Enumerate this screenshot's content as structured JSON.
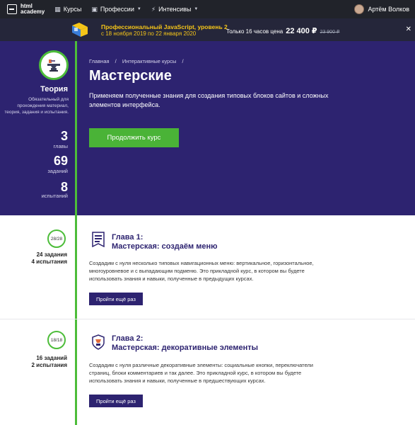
{
  "nav": {
    "logo_line1": "html",
    "logo_line2": "academy",
    "items": [
      {
        "label": "Курсы",
        "icon": "grid-icon"
      },
      {
        "label": "Профессии",
        "icon": "briefcase-icon"
      },
      {
        "label": "Интенсивы",
        "icon": "bolt-icon"
      }
    ],
    "user": "Артём Волков"
  },
  "promo": {
    "title": "Профессиональный JavaScript, уровень 2",
    "dates": "с 18 ноября 2019 по 22 января 2020",
    "offer": "Только 16 часов цена",
    "price": "22 400 ₽",
    "old_price": "23 900 ₽"
  },
  "sidebar": {
    "section": "Теория",
    "description": "Обязательный для прохождения материал, теория, задания и испытания.",
    "stats": [
      {
        "value": "3",
        "label": "главы"
      },
      {
        "value": "69",
        "label": "заданий"
      },
      {
        "value": "8",
        "label": "испытаний"
      }
    ]
  },
  "hero": {
    "breadcrumbs": [
      "Главная",
      "/",
      "Интерактивные курсы",
      "/"
    ],
    "title": "Мастерские",
    "description": "Применяем полученные знания для создания типовых блоков сайтов и сложных элементов интерфейса.",
    "cta": "Продолжить курс"
  },
  "chapters": [
    {
      "progress": "28/28",
      "tasks": "24 задания",
      "trials": "4 испытания",
      "label": "Глава 1:",
      "title": "Мастерская: создаём меню",
      "description": "Создадим с нуля несколько типовых навигационных меню: вертикальное, горизонтальное, многоуровневое и с выпадающим подменю. Это прикладной курс, в котором вы будете использовать знания и навыки, полученные в предыдущих курсах.",
      "button": "Пройти ещё раз"
    },
    {
      "progress": "18/18",
      "tasks": "16 заданий",
      "trials": "2 испытания",
      "label": "Глава 2:",
      "title": "Мастерская: декоративные элементы",
      "description": "Создадим с нуля различные декоративные элементы: социальные кнопки, переключатели страниц, блоки комментариев и так далее. Это прикладной курс, в котором вы будете использовать знания и навыки, полученные в предшествующих курсах.",
      "button": "Пройти ещё раз"
    }
  ],
  "colors": {
    "nav_bg": "#21232a",
    "promo_bg": "#25263a",
    "hero_bg": "#2d2370",
    "accent_green": "#4ab337",
    "accent_yellow": "#f5c518"
  }
}
